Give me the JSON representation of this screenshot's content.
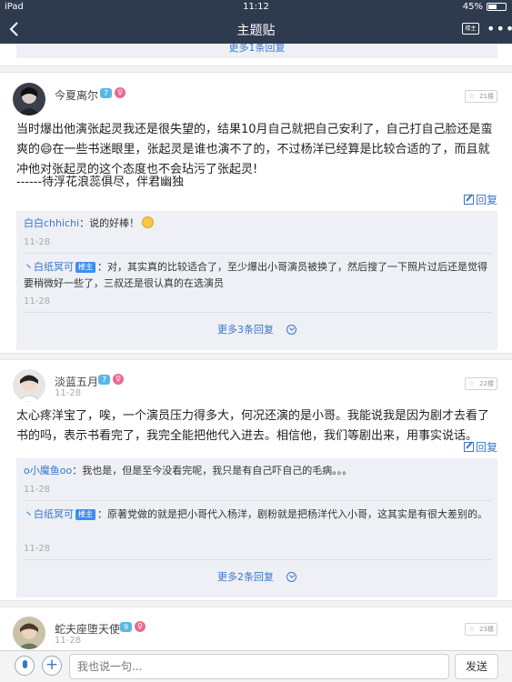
{
  "statusbar": {
    "carrier": "iPad",
    "time": "11:12",
    "battery": "45%"
  },
  "nav": {
    "title": "主题贴",
    "louzhu": "楼主",
    "more": "•••"
  },
  "prev_more": "更多1条回复",
  "posts": [
    {
      "user": "今夏离尔",
      "level": "7",
      "gender": "♀",
      "floor": "21楼",
      "text": "当时爆出他演张起灵我还是很失望的，结果10月自己就把自己安利了，自己打自己脸还是蛮爽的😄在一些书迷眼里，张起灵是谁也演不了的，不过杨洋已经算是比较合适的了，而且就冲他对张起灵的这个态度也不会玷污了张起灵!",
      "signature": " ------待浮花浪蕊俱尽，伴君幽独",
      "reply_label": "回复",
      "comments": [
        {
          "name": "白白chhichi",
          "badge": "",
          "text": "：说的好棒！",
          "date": "11-28"
        },
        {
          "name": "丶白纸冥可",
          "badge": "楼主",
          "text": "：对，其实真的比较适合了，至少爆出小哥演员被换了，然后搜了一下照片过后还是觉得要稍微好一些了，三叔还是很认真的在选演员",
          "date": "11-28"
        }
      ],
      "more": "更多3条回复"
    },
    {
      "user": "淡蓝五月",
      "level": "7",
      "gender": "♀",
      "floor": "22楼",
      "date": "11-28",
      "text": "太心疼洋宝了，唉，一个演员压力得多大，何况还演的是小哥。我能说我是因为剧才去看了书的吗，表示书看完了，我完全能把他代入进去。相信他，我们等剧出来，用事实说话。",
      "reply_label": "回复",
      "comments": [
        {
          "name": "o小魔鱼oo",
          "badge": "",
          "text": "：我也是，但是至今没看完呢，我只是有自己吓自己的毛病。。。",
          "date": "11-28"
        },
        {
          "name": "丶白纸冥可",
          "badge": "楼主",
          "text": "：原著党做的就是把小哥代入杨洋，剧粉就是把杨洋代入小哥，这其实是有很大差别的。",
          "date": "11-28"
        }
      ],
      "more": "更多2条回复"
    },
    {
      "user": "蛇夫座堕天使",
      "level": "9",
      "gender": "♀",
      "floor": "23楼",
      "date": "11-28"
    }
  ],
  "bottom": {
    "placeholder": "我也说一句...",
    "send": "发送"
  }
}
